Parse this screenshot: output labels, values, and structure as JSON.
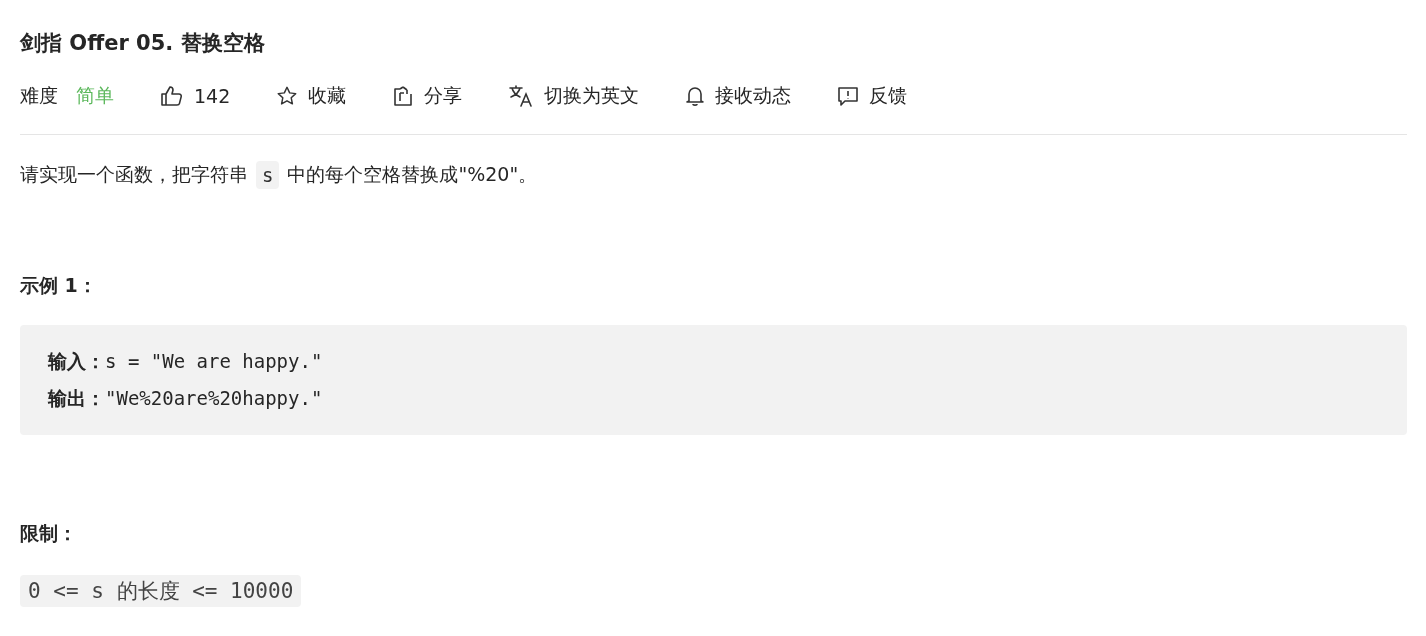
{
  "title": "剑指 Offer 05. 替换空格",
  "difficulty": {
    "label": "难度",
    "value": "简单",
    "color": "#5cb85c"
  },
  "actions": [
    {
      "kind": "like",
      "label": "142"
    },
    {
      "kind": "star",
      "label": "收藏"
    },
    {
      "kind": "share",
      "label": "分享"
    },
    {
      "kind": "translate",
      "label": "切换为英文"
    },
    {
      "kind": "bell",
      "label": "接收动态"
    },
    {
      "kind": "feedback",
      "label": "反馈"
    }
  ],
  "description": {
    "before": "请实现一个函数，把字符串",
    "code": "s",
    "after": "中的每个空格替换成\"%20\"。"
  },
  "example": {
    "heading": "示例 1：",
    "lines": [
      "**输入：**s = \"We are happy.\"",
      "**输出：**\"We%20are%20happy.\""
    ]
  },
  "limits": {
    "heading": "限制：",
    "code": "0 <= s 的长度 <= 10000"
  }
}
